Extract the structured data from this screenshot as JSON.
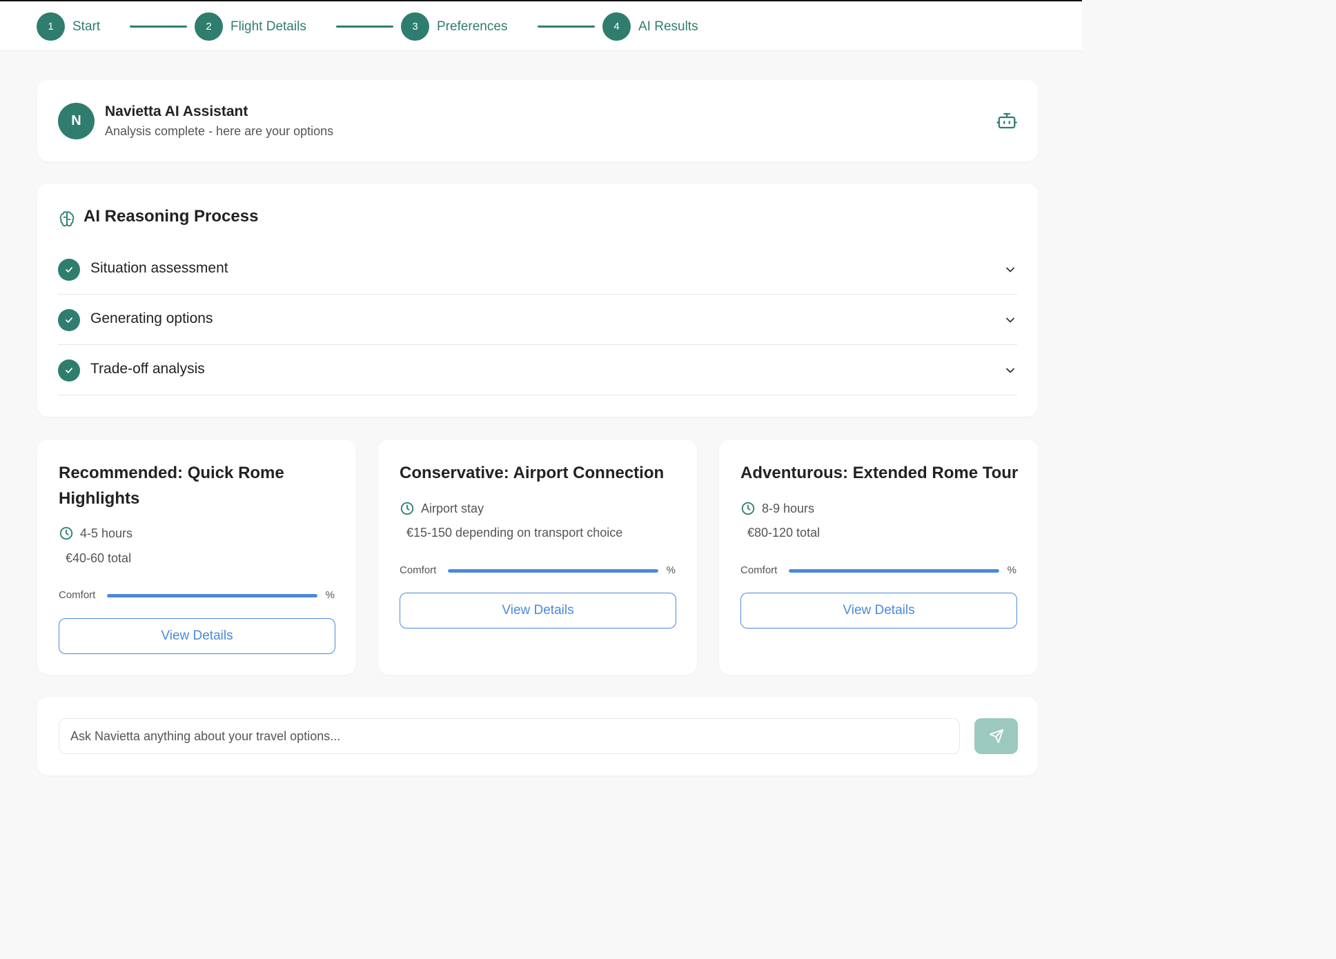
{
  "stepper": {
    "steps": [
      {
        "num": "1",
        "label": "Start"
      },
      {
        "num": "2",
        "label": "Flight Details"
      },
      {
        "num": "3",
        "label": "Preferences"
      },
      {
        "num": "4",
        "label": "AI Results"
      }
    ]
  },
  "assistant": {
    "avatar_letter": "N",
    "name": "Navietta AI Assistant",
    "status": "Analysis complete - here are your options",
    "icon": "robot-icon"
  },
  "reasoning": {
    "title": "AI Reasoning Process",
    "icon": "brain-icon",
    "items": [
      {
        "label": "Situation assessment",
        "status": "complete"
      },
      {
        "label": "Generating options",
        "status": "complete"
      },
      {
        "label": "Trade-off analysis",
        "status": "complete"
      }
    ]
  },
  "options": [
    {
      "title": "Recommended: Quick Rome Highlights",
      "duration": "4-5 hours",
      "cost": "€40-60 total",
      "comfort_label": "Comfort",
      "comfort_suffix": "%",
      "comfort_fraction": 1.0,
      "button": "View Details"
    },
    {
      "title": "Conservative: Airport Connection",
      "duration": "Airport stay",
      "cost": "€15-150 depending on transport choice",
      "comfort_label": "Comfort",
      "comfort_suffix": "%",
      "comfort_fraction": 1.0,
      "button": "View Details"
    },
    {
      "title": "Adventurous: Extended Rome Tour",
      "duration": "8-9 hours",
      "cost": "€80-120 total",
      "comfort_label": "Comfort",
      "comfort_suffix": "%",
      "comfort_fraction": 1.0,
      "button": "View Details"
    }
  ],
  "chat": {
    "placeholder": "Ask Navietta anything about your travel options...",
    "send_icon": "send-icon"
  },
  "colors": {
    "primary": "#2f7d6e",
    "accent_blue": "#4a89dc",
    "send_disabled": "#9cc9bd",
    "background": "#f8f8f8"
  }
}
